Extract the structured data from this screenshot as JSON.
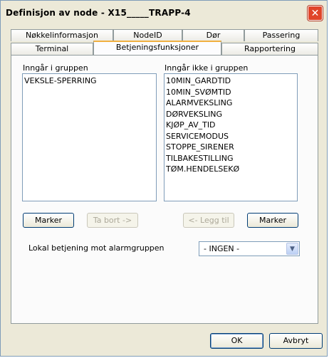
{
  "window": {
    "title": "Definisjon av node - X15_____TRAPP-4"
  },
  "tabs_row1": [
    {
      "label": "Nøkkelinformasjon"
    },
    {
      "label": "NodeID"
    },
    {
      "label": "Dør"
    },
    {
      "label": "Passering"
    }
  ],
  "tabs_row2": [
    {
      "label": "Terminal"
    },
    {
      "label": "Betjeningsfunksjoner",
      "active": true
    },
    {
      "label": "Rapportering"
    }
  ],
  "included": {
    "label": "Inngår i gruppen",
    "items": [
      "VEKSLE-SPERRING"
    ]
  },
  "not_included": {
    "label": "Inngår ikke i gruppen",
    "items": [
      "10MIN_GARDTID",
      "10MIN_SVØMTID",
      "ALARMVEKSLING",
      "DØRVEKSLING",
      "KJØP_AV_TID",
      "SERVICEMODUS",
      "STOPPE_SIRENER",
      "TILBAKESTILLING",
      "TØM.HENDELSEKØ"
    ]
  },
  "buttons": {
    "marker_left": "Marker",
    "remove": "Ta bort  ->",
    "add": "<-  Legg til",
    "marker_right": "Marker",
    "ok": "OK",
    "cancel": "Avbryt"
  },
  "local_control": {
    "label": "Lokal betjening mot alarmgruppen",
    "value": "- INGEN -"
  }
}
